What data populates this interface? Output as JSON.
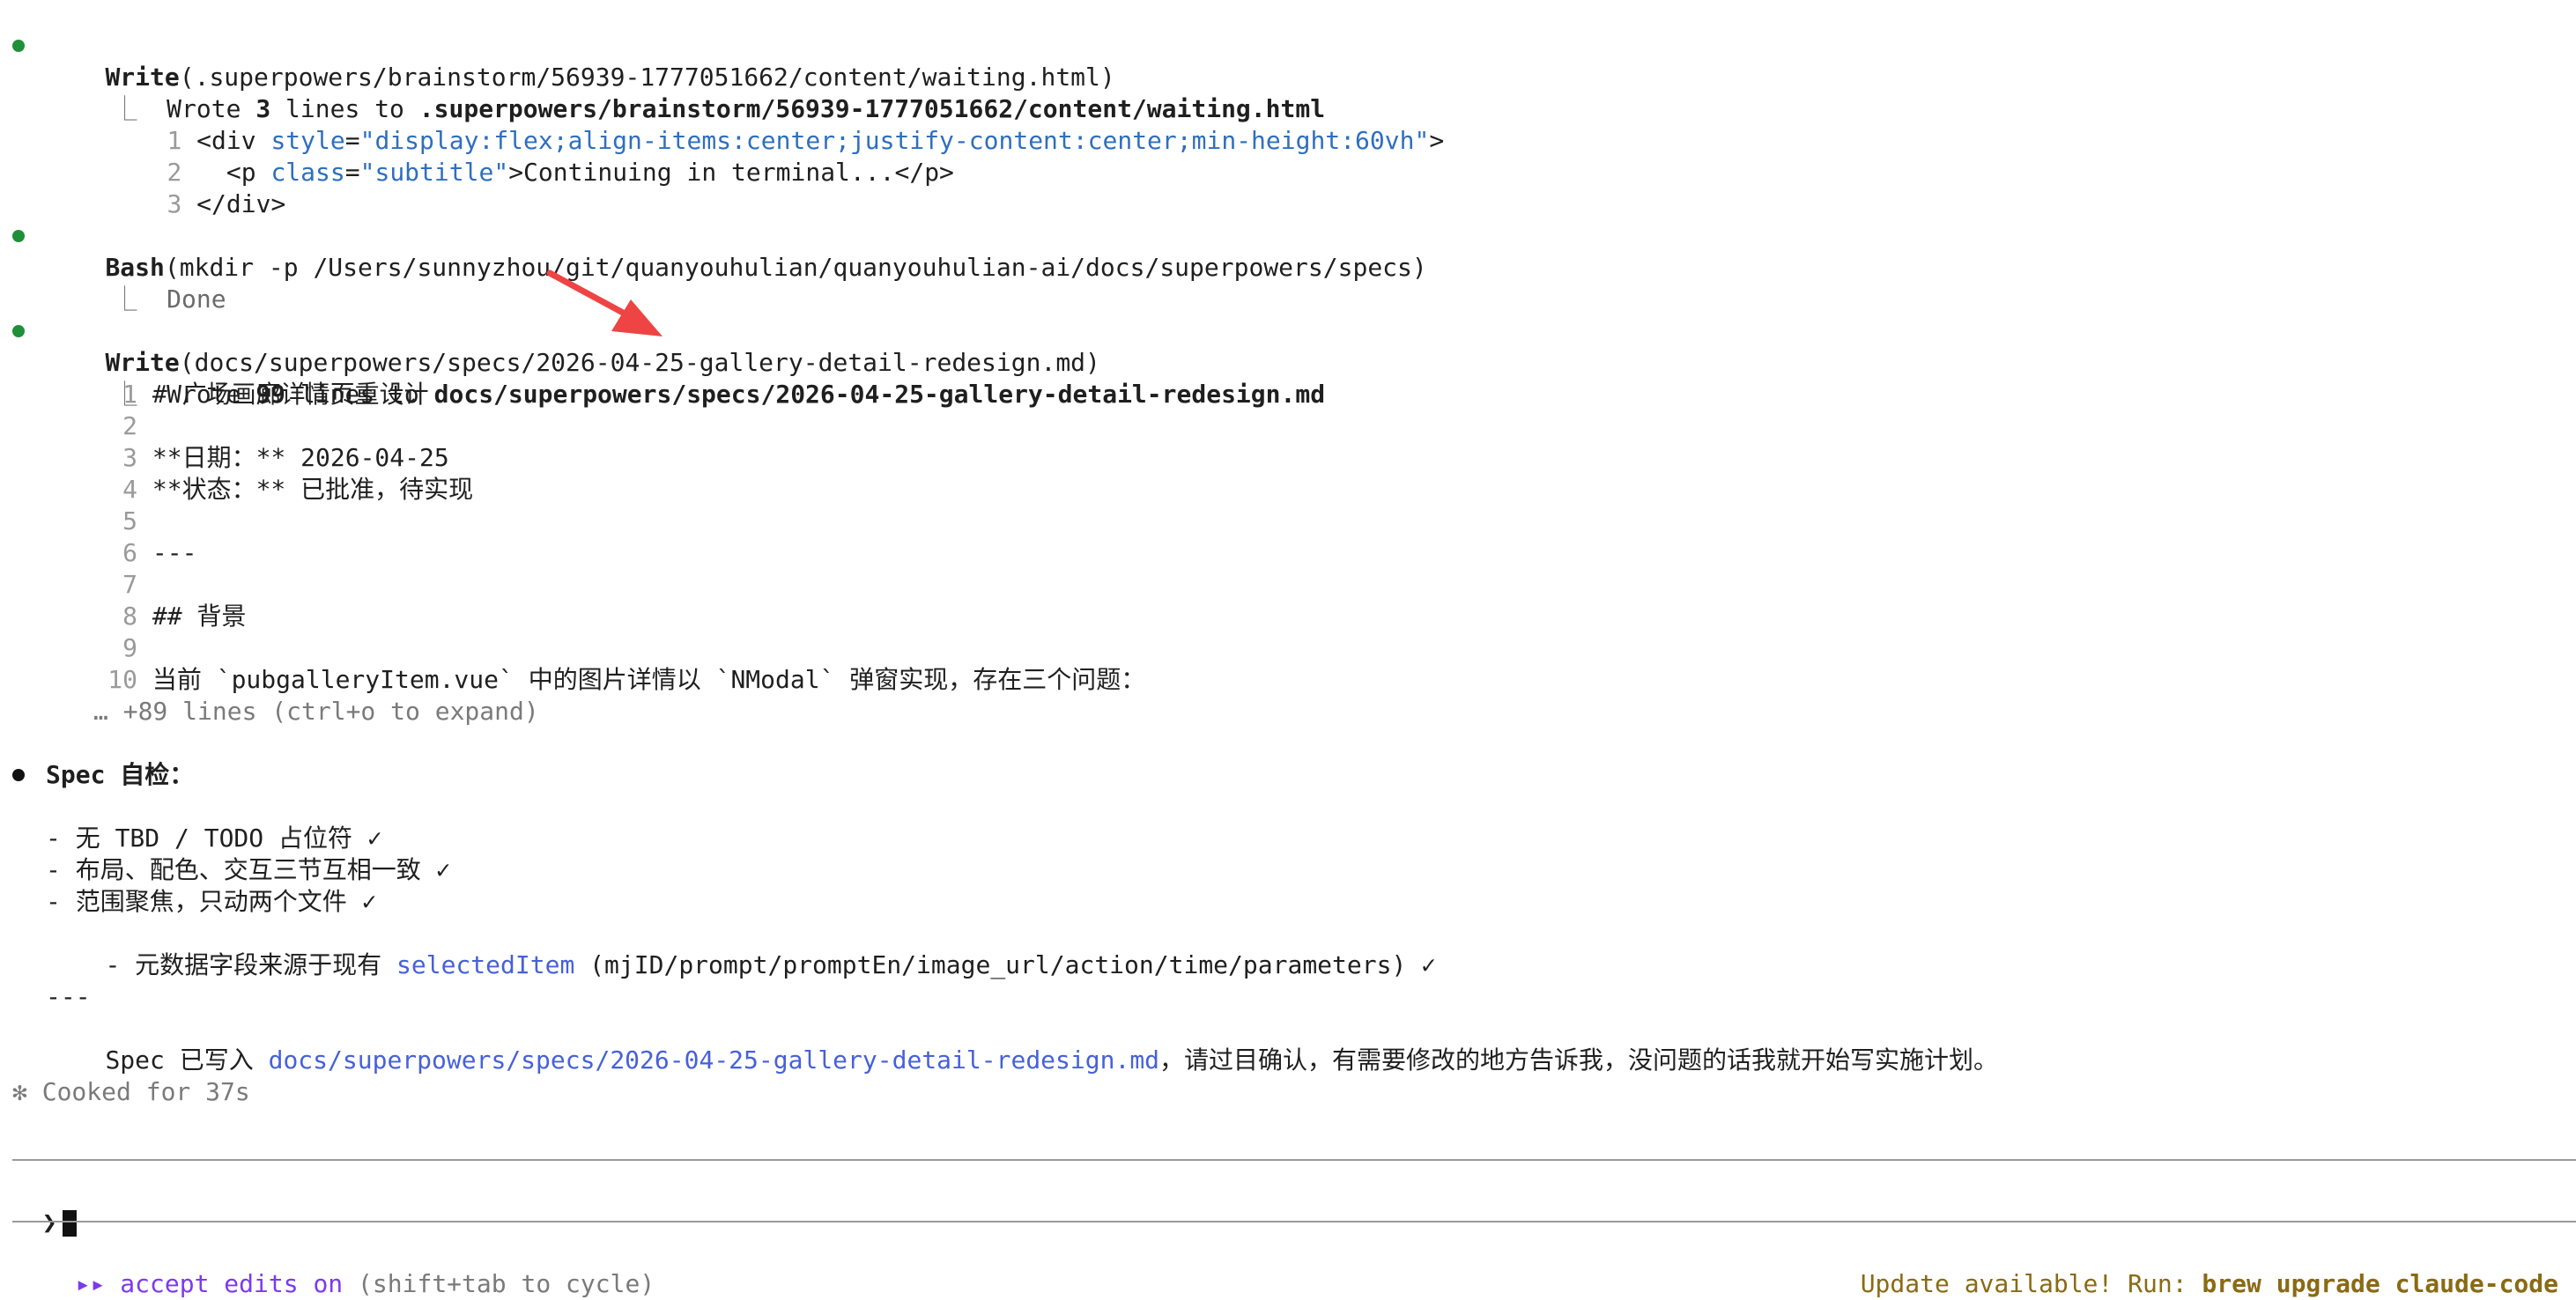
{
  "blocks": {
    "write1": {
      "tool": "Write",
      "args": "(.superpowers/brainstorm/56939-1777051662/content/waiting.html)",
      "result_prefix": "Wrote ",
      "result_count": "3",
      "result_mid": " lines to ",
      "result_path": ".superpowers/brainstorm/56939-1777051662/content/waiting.html",
      "code": [
        {
          "n": "1",
          "t1": "<div ",
          "a1": "style",
          "eq": "=",
          "s1": "\"display:flex;align-items:center;justify-content:center;min-height:60vh\"",
          "t2": ">"
        },
        {
          "n": "2",
          "t1": "  <p ",
          "a1": "class",
          "eq": "=",
          "s1": "\"subtitle\"",
          "t2": ">Continuing in terminal...</p>"
        },
        {
          "n": "3",
          "t1": "</div>"
        }
      ]
    },
    "bash": {
      "tool": "Bash",
      "args": "(mkdir -p /Users/sunnyzhou/git/quanyouhulian/quanyouhulian-ai/docs/superpowers/specs)",
      "result": "Done"
    },
    "write2": {
      "tool": "Write",
      "args": "(docs/superpowers/specs/2026-04-25-gallery-detail-redesign.md)",
      "result_prefix": "Wrote ",
      "result_count": "99",
      "result_mid": " lines to ",
      "result_path": "docs/superpowers/specs/2026-04-25-gallery-detail-redesign.md",
      "lines": [
        {
          "n": "1",
          "t": "# 广场画廊详情页重设计"
        },
        {
          "n": "2",
          "t": ""
        },
        {
          "n": "3",
          "t": "**日期：** 2026-04-25"
        },
        {
          "n": "4",
          "t": "**状态：** 已批准，待实现"
        },
        {
          "n": "5",
          "t": ""
        },
        {
          "n": "6",
          "t": "---"
        },
        {
          "n": "7",
          "t": ""
        },
        {
          "n": "8",
          "t": "## 背景"
        },
        {
          "n": "9",
          "t": ""
        },
        {
          "n": "10",
          "t": "当前 `pubgalleryItem.vue` 中的图片详情以 `NModal` 弹窗实现，存在三个问题："
        }
      ],
      "more": "… +89 lines (ctrl+o to expand)"
    },
    "spec": {
      "title": "Spec 自检：",
      "items": [
        "- 无 TBD / TODO 占位符 ✓",
        "- 布局、配色、交互三节互相一致 ✓",
        "- 范围聚焦，只动两个文件 ✓"
      ],
      "item4_prefix": "- 元数据字段来源于现有 ",
      "item4_link": "selectedItem",
      "item4_suffix": " (mjID/prompt/promptEn/image_url/action/time/parameters) ✓",
      "divider": "---",
      "final_prefix": "Spec 已写入 ",
      "final_link": "docs/superpowers/specs/2026-04-25-gallery-detail-redesign.md",
      "final_suffix": "，请过目确认，有需要修改的地方告诉我，没问题的话我就开始写实施计划。"
    },
    "cooked": "✻ Cooked for 37s"
  },
  "prompt": {
    "symbol": "❯"
  },
  "status": {
    "mode_icon": "▸▸",
    "mode_label": "accept edits on",
    "mode_hint": " (shift+tab to cycle)",
    "update_prefix": "Update available! Run: ",
    "update_cmd": "brew upgrade claude-code"
  },
  "colors": {
    "bullet_green": "#1f8f3a",
    "link": "#4661d9",
    "attr": "#2f6fbe",
    "mode": "#7c3aed",
    "update": "#8a6a14",
    "arrow": "#ef4444"
  },
  "icons": {
    "bullet": "filled-circle",
    "result_branch": "tree-corner-glyph",
    "annotation": "red-arrow"
  }
}
